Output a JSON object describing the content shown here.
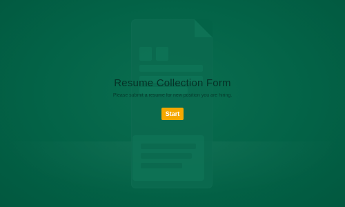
{
  "form": {
    "title": "Resume Collection Form",
    "description": "Please submit a resume for new position you are hiring.",
    "start_button_label": "Start"
  },
  "theme": {
    "background": "#036347",
    "button_color": "#f5a800",
    "text_color": "#053126",
    "button_text_color": "#ffffff"
  }
}
